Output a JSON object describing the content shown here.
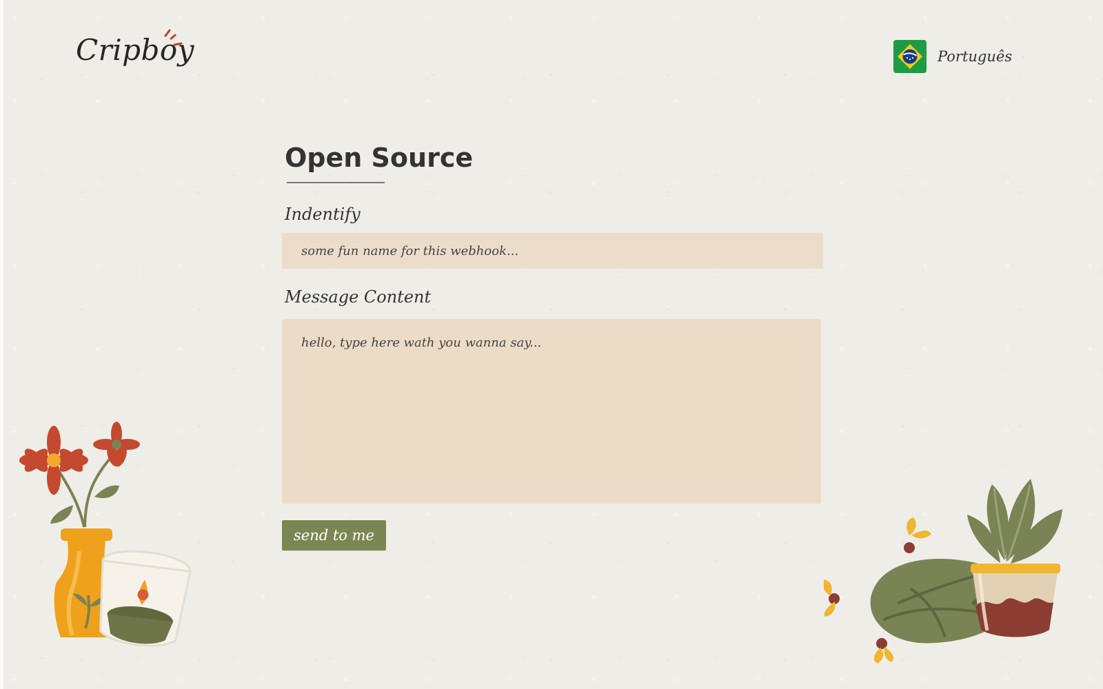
{
  "brand": {
    "name": "Cripboy"
  },
  "language": {
    "label": "Português",
    "flag_icon": "brazil-flag-icon",
    "chevron_icon": "chevron-down-icon"
  },
  "page": {
    "title": "Open Source"
  },
  "form": {
    "identify_label": "Indentify",
    "identify_placeholder": "some fun name for this webhook...",
    "message_label": "Message Content",
    "message_placeholder": "hello, type here wath you wanna say...",
    "submit_label": "send to me"
  },
  "colors": {
    "background": "#efede8",
    "input_background": "#ecddca",
    "button_background": "#7b8752",
    "text": "#333333"
  },
  "illustrations": {
    "left": "flower-vase-candle-illustration",
    "right": "plant-pot-cushion-illustration"
  }
}
